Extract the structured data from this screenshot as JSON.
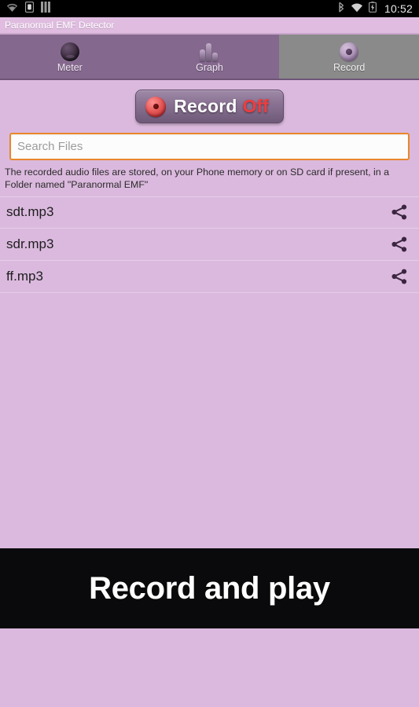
{
  "status_bar": {
    "icons_left": [
      "wifi-signal-icon",
      "sim-card-icon",
      "sd-storage-icon"
    ],
    "icons_right": [
      "bluetooth-icon",
      "wifi-icon",
      "battery-icon"
    ],
    "time": "10:52"
  },
  "app": {
    "title": "Paranormal EMF Detector"
  },
  "tabs": [
    {
      "label": "Meter",
      "icon": "sphere-meter-icon",
      "selected": false
    },
    {
      "label": "Graph",
      "icon": "bar-graph-icon",
      "selected": false
    },
    {
      "label": "Record",
      "icon": "record-eye-icon",
      "selected": true
    }
  ],
  "record_button": {
    "label": "Record",
    "state": "Off",
    "icon": "record-dot-icon"
  },
  "search": {
    "value": "",
    "placeholder": "Search Files"
  },
  "hint": "The recorded audio files are stored, on your Phone memory or on SD card if present, in a Folder named \"Paranormal EMF\"",
  "files": [
    {
      "name": "sdt.mp3",
      "action_icon": "share-icon"
    },
    {
      "name": "sdr.mp3",
      "action_icon": "share-icon"
    },
    {
      "name": "ff.mp3",
      "action_icon": "share-icon"
    }
  ],
  "banner": {
    "text": "Record and play"
  },
  "colors": {
    "content_bg": "#DBB9DE",
    "tab_unselected": "#85688E",
    "tab_selected": "#8A8A8A",
    "title_bar": "#DFBCE0",
    "search_border": "#E8872A",
    "record_off": "#EF3D3D",
    "banner_bg": "#0A0A0C"
  }
}
